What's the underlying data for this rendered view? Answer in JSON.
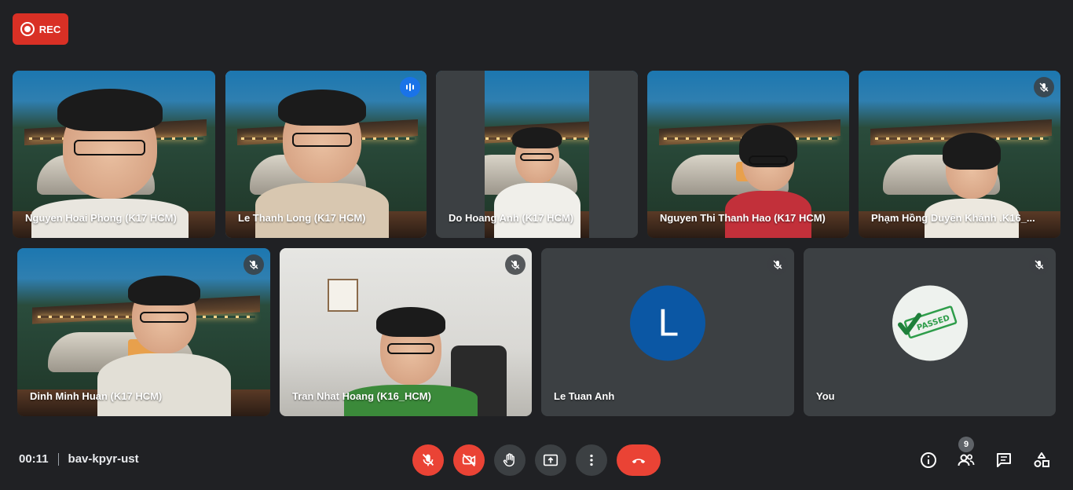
{
  "recording": {
    "label": "REC",
    "color": "#d93025"
  },
  "participants_row1": [
    {
      "name": "Nguyen Hoai Phong (K17 HCM)",
      "muted": false,
      "speaking": false
    },
    {
      "name": "Le Thanh Long (K17 HCM)",
      "muted": false,
      "speaking": true
    },
    {
      "name": "Do Hoang Anh (K17 HCM)",
      "muted": false,
      "speaking": false
    },
    {
      "name": "Nguyen Thi Thanh Hao (K17 HCM)",
      "muted": false,
      "speaking": false
    },
    {
      "name": "Phạm Hồng Duyên Khánh .K16_...",
      "muted": true,
      "speaking": false
    }
  ],
  "participants_row2": [
    {
      "name": "Dinh Minh Huan (K17 HCM)",
      "muted": true
    },
    {
      "name": "Tran Nhat Hoang (K16_HCM)",
      "muted": true
    },
    {
      "name": "Le Tuan Anh",
      "muted": true,
      "avatar_letter": "L"
    },
    {
      "name": "You",
      "muted": true,
      "avatar_image": "passed-stamp"
    }
  ],
  "passed_stamp_text": "PASSED",
  "meeting": {
    "time": "00:11",
    "code": "bav-kpyr-ust"
  },
  "controls": {
    "mic": "mic-off-icon",
    "camera": "camera-off-icon",
    "raise_hand": "hand-icon",
    "present": "present-screen-icon",
    "more": "more-vert-icon",
    "end_call": "end-call-icon"
  },
  "people_count": "9",
  "colors": {
    "background": "#202124",
    "tile": "#3c4043",
    "accent_red": "#ea4335",
    "active_outline": "#8ab4f8"
  }
}
